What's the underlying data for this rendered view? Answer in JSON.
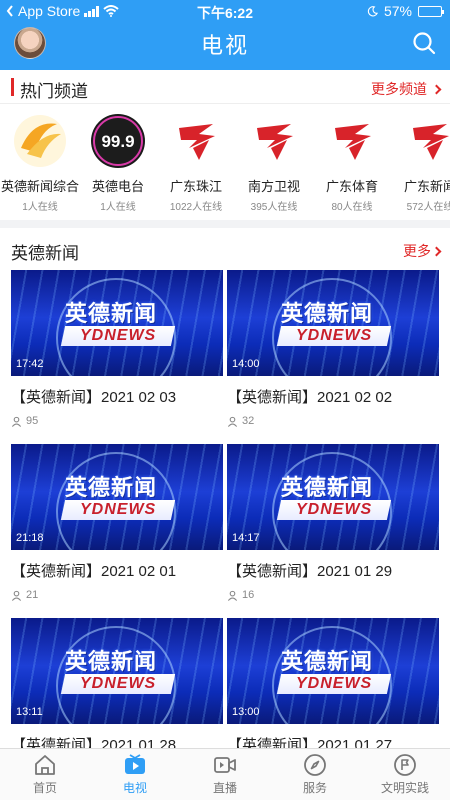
{
  "status_bar": {
    "back_app": "App Store",
    "time": "下午6:22",
    "battery": "57%",
    "battery_level": 0.57
  },
  "header": {
    "title": "电视"
  },
  "hot_channels": {
    "title": "热门频道",
    "more_label": "更多频道",
    "items": [
      {
        "name": "英德新闻综合",
        "online": "1人在线",
        "logo": "yingde-news-logo"
      },
      {
        "name": "英德电台",
        "online": "1人在线",
        "logo": "fm999-logo"
      },
      {
        "name": "广东珠江",
        "online": "1022人在线",
        "logo": "guangdong-tv-logo"
      },
      {
        "name": "南方卫视",
        "online": "395人在线",
        "logo": "guangdong-tv-logo"
      },
      {
        "name": "广东体育",
        "online": "80人在线",
        "logo": "guangdong-tv-logo"
      },
      {
        "name": "广东新闻",
        "online": "572人在线",
        "logo": "guangdong-tv-logo"
      }
    ],
    "fm_text": "99.9"
  },
  "news": {
    "title": "英德新闻",
    "more_label": "更多",
    "thumb_logo_cn": "英德新闻",
    "thumb_logo_en": "YDNEWS",
    "items": [
      {
        "title": "【英德新闻】2021 02 03",
        "views": "95",
        "duration": "17:42"
      },
      {
        "title": "【英德新闻】2021 02 02",
        "views": "32",
        "duration": "14:00"
      },
      {
        "title": "【英德新闻】2021 02 01",
        "views": "21",
        "duration": "21:18"
      },
      {
        "title": "【英德新闻】2021 01 29",
        "views": "16",
        "duration": "14:17"
      },
      {
        "title": "【英德新闻】2021 01 28",
        "views": "",
        "duration": "13:11"
      },
      {
        "title": "【英德新闻】2021 01 27",
        "views": "",
        "duration": "13:00"
      }
    ]
  },
  "tabs": [
    {
      "label": "首页",
      "icon": "home-icon",
      "active": false
    },
    {
      "label": "电视",
      "icon": "tv-icon",
      "active": true
    },
    {
      "label": "直播",
      "icon": "live-camera-icon",
      "active": false
    },
    {
      "label": "服务",
      "icon": "compass-icon",
      "active": false
    },
    {
      "label": "文明实践",
      "icon": "flag-icon",
      "active": false
    }
  ],
  "colors": {
    "brand_blue": "#2f9ef5",
    "accent_red": "#e02828",
    "text_gray": "#888888"
  }
}
